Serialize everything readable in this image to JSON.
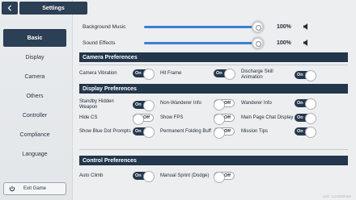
{
  "header": {
    "title": "Settings"
  },
  "sidebar": {
    "items": [
      {
        "label": "Basic",
        "active": true
      },
      {
        "label": "Display",
        "active": false
      },
      {
        "label": "Camera",
        "active": false
      },
      {
        "label": "Others",
        "active": false
      },
      {
        "label": "Controller",
        "active": false
      },
      {
        "label": "Compliance",
        "active": false
      },
      {
        "label": "Language",
        "active": false
      }
    ],
    "exit_label": "Exit Game"
  },
  "audio": {
    "bgm_label": "Background Music",
    "bgm_value": "100%",
    "bgm_level": 1.0,
    "sfx_label": "Sound Effects",
    "sfx_value": "100%",
    "sfx_level": 1.0
  },
  "camera": {
    "title": "Camera Preferences",
    "items": [
      {
        "label": "Camera Vibration",
        "state": "On"
      },
      {
        "label": "Hit Frame",
        "state": "On"
      },
      {
        "label": "Discharge Skill Animation",
        "state": "On"
      }
    ]
  },
  "display": {
    "title": "Display Preferences",
    "items": [
      {
        "label": "Standby Hidden Weapon",
        "state": "On"
      },
      {
        "label": "Non-Wanderer Info",
        "state": "Off"
      },
      {
        "label": "Wanderer Info",
        "state": "On"
      },
      {
        "label": "Hide CS",
        "state": "Off"
      },
      {
        "label": "Show FPS",
        "state": "Off"
      },
      {
        "label": "Main Page Chat Display",
        "state": "On"
      },
      {
        "label": "Show Blue Dot Prompts",
        "state": "On"
      },
      {
        "label": "Permanent Folding Buff",
        "state": "Off"
      },
      {
        "label": "Mission Tips",
        "state": "On"
      }
    ]
  },
  "control": {
    "title": "Control Preferences",
    "items": [
      {
        "label": "Auto Climb",
        "state": "On"
      },
      {
        "label": "Manual Sprint (Dodge)",
        "state": "Off"
      }
    ]
  },
  "footer": {
    "uid": "UID: 1104000488"
  },
  "colors": {
    "accent": "#22364c",
    "slider": "#3b7fd6"
  }
}
